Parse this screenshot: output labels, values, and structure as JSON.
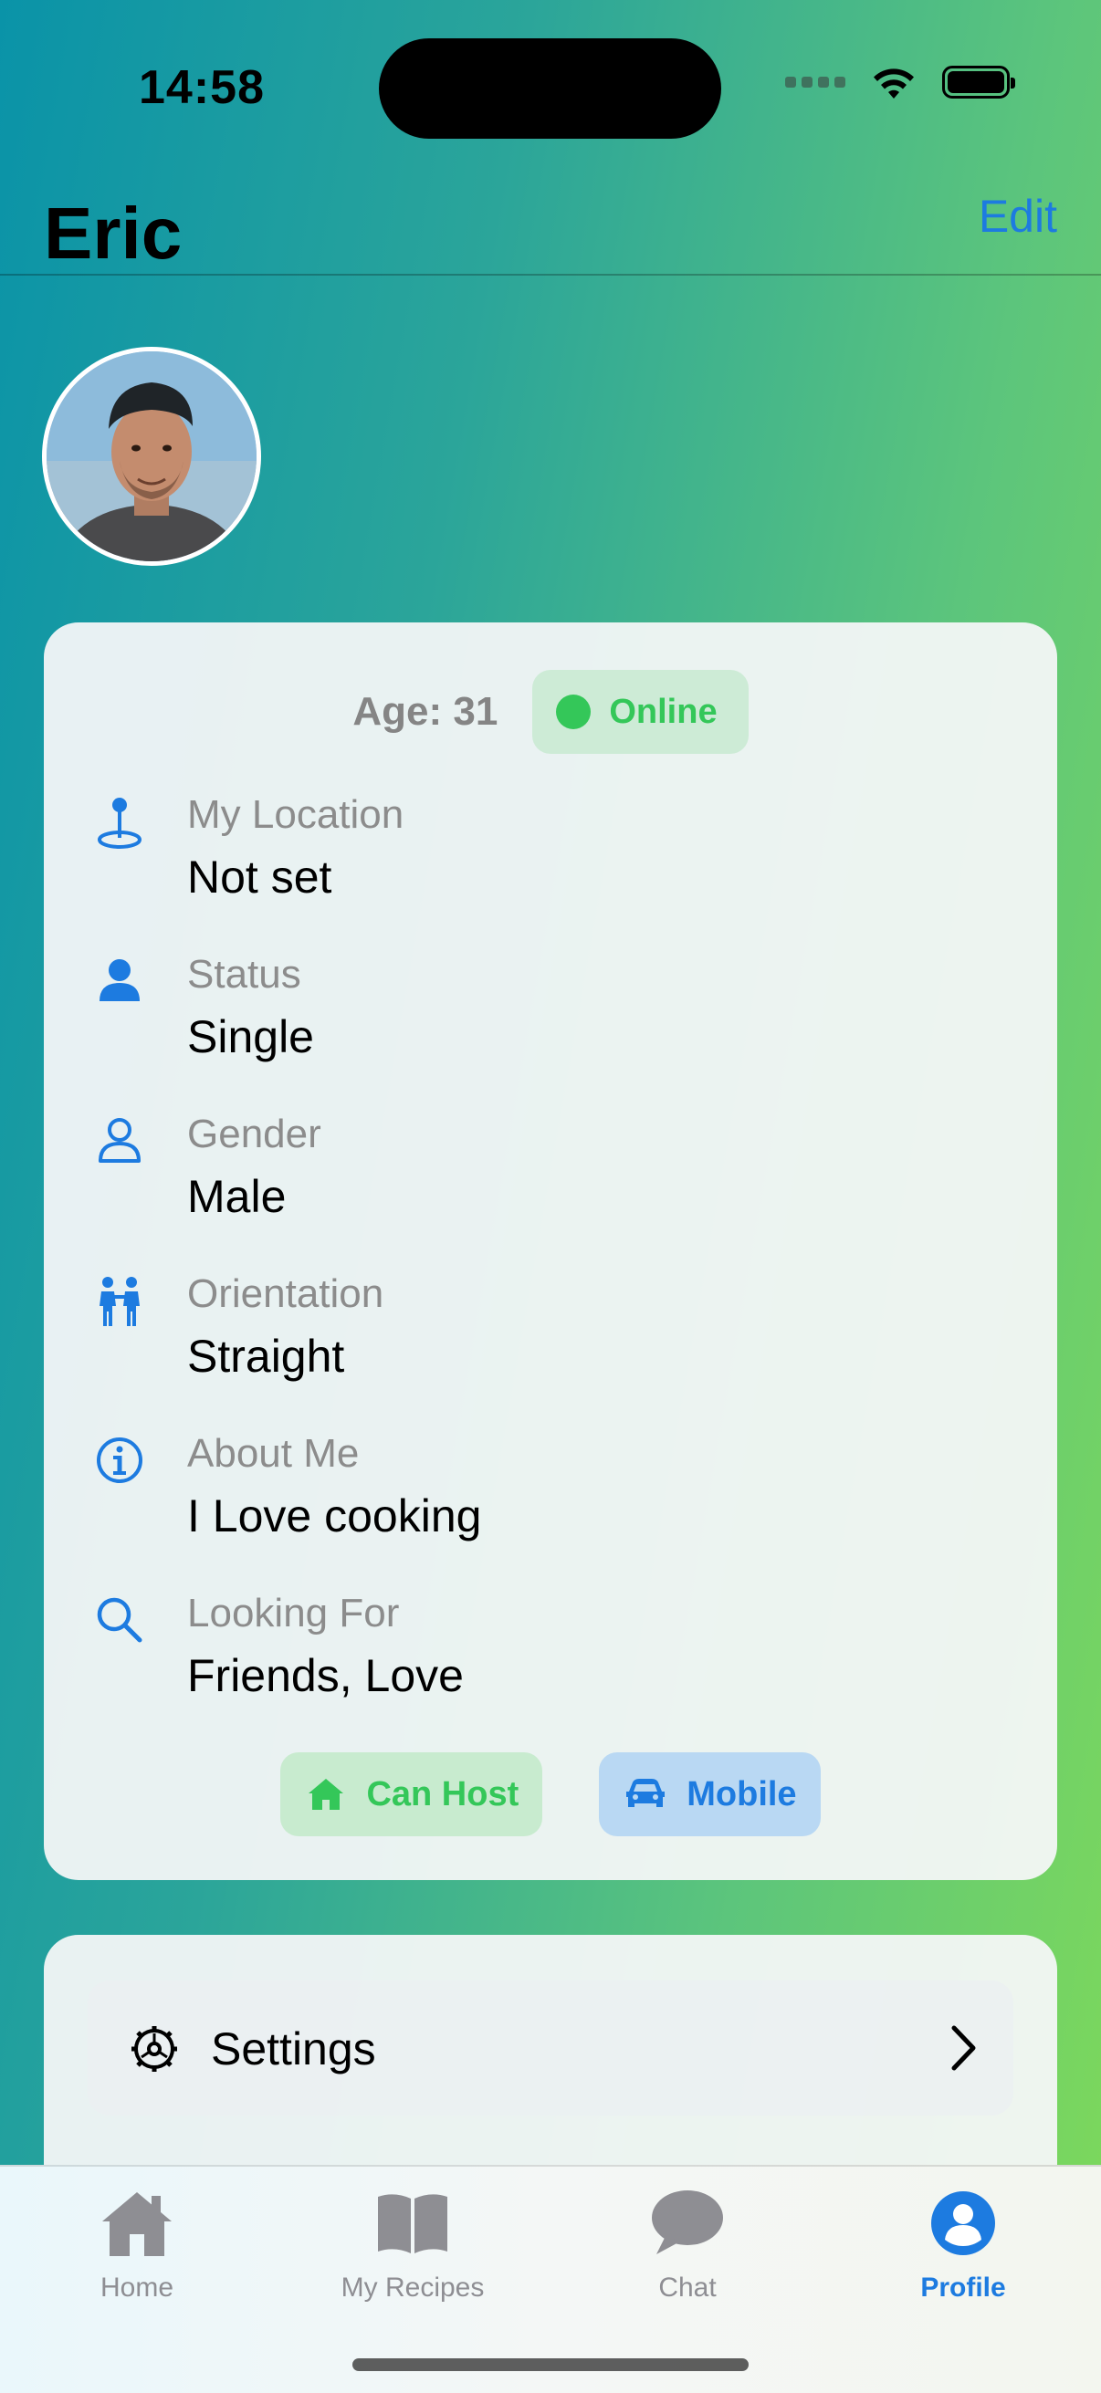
{
  "status_bar": {
    "time": "14:58"
  },
  "header": {
    "title": "Eric",
    "edit_label": "Edit"
  },
  "profile": {
    "age_label": "Age: 31",
    "online_label": "Online",
    "info": [
      {
        "icon": "location-pin-icon",
        "label": "My Location",
        "value": "Not set"
      },
      {
        "icon": "person-fill-icon",
        "label": "Status",
        "value": "Single"
      },
      {
        "icon": "person-outline-icon",
        "label": "Gender",
        "value": "Male"
      },
      {
        "icon": "two-people-icon",
        "label": "Orientation",
        "value": "Straight"
      },
      {
        "icon": "info-circle-icon",
        "label": "About Me",
        "value": "I Love cooking"
      },
      {
        "icon": "magnifying-glass-icon",
        "label": "Looking For",
        "value": "Friends, Love"
      }
    ],
    "chips": [
      {
        "icon": "house-icon",
        "label": "Can Host"
      },
      {
        "icon": "car-icon",
        "label": "Mobile"
      }
    ]
  },
  "settings": {
    "label": "Settings"
  },
  "tabbar": {
    "tabs": [
      {
        "icon": "house-icon",
        "label": "Home"
      },
      {
        "icon": "book-icon",
        "label": "My Recipes"
      },
      {
        "icon": "speech-bubble-icon",
        "label": "Chat"
      },
      {
        "icon": "person-circle-icon",
        "label": "Profile"
      }
    ],
    "active": "Profile"
  },
  "colors": {
    "accent": "#1d7be0",
    "online_green": "#34c759",
    "gradient_left": "#0a93a8",
    "gradient_right": "#7ed95a"
  }
}
